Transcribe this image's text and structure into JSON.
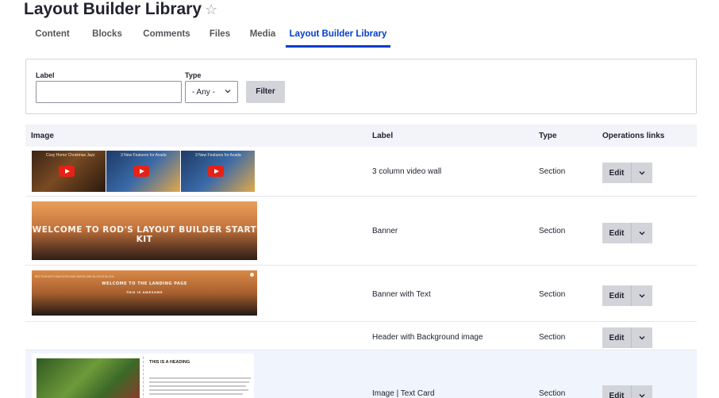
{
  "page": {
    "title": "Layout Builder Library"
  },
  "tabs": [
    {
      "label": "Content"
    },
    {
      "label": "Blocks"
    },
    {
      "label": "Comments"
    },
    {
      "label": "Files"
    },
    {
      "label": "Media"
    },
    {
      "label": "Layout Builder Library",
      "active": true
    }
  ],
  "filter": {
    "label_field": {
      "label": "Label",
      "value": "",
      "placeholder": ""
    },
    "type_field": {
      "label": "Type",
      "selected": "- Any -"
    },
    "submit_label": "Filter"
  },
  "table": {
    "headers": {
      "image": "Image",
      "label": "Label",
      "type": "Type",
      "operations": "Operations links"
    },
    "rows": [
      {
        "label": "3 column video wall",
        "type": "Section",
        "edit_label": "Edit"
      },
      {
        "label": "Banner",
        "type": "Section",
        "edit_label": "Edit"
      },
      {
        "label": "Banner with Text",
        "type": "Section",
        "edit_label": "Edit"
      },
      {
        "label": "Header with Background image",
        "type": "Section",
        "edit_label": "Edit"
      },
      {
        "label": "Image | Text Card",
        "type": "Section",
        "edit_label": "Edit"
      }
    ]
  },
  "thumbnails": {
    "video_titles": [
      "Cosy Home Christmas Jazz",
      "3 New Features for Avada",
      "3 New Features for Avada"
    ],
    "banner_text": "WELCOME TO ROD'S  LAYOUT BUILDER START KIT",
    "banner_with_text": {
      "small": "SECTION WITH BACKGROUND IMAGE AND BLOCKS BLOCK",
      "heading": "WELCOME TO THE LANDING PAGE",
      "sub": "THIS IS AWESOME"
    },
    "card_heading": "THIS IS A HEADING"
  },
  "colors": {
    "accent": "#003ecc",
    "button_bg": "#d3d4d9",
    "header_bg": "#f3f4f9",
    "highlight_row": "#f0f5fd"
  }
}
